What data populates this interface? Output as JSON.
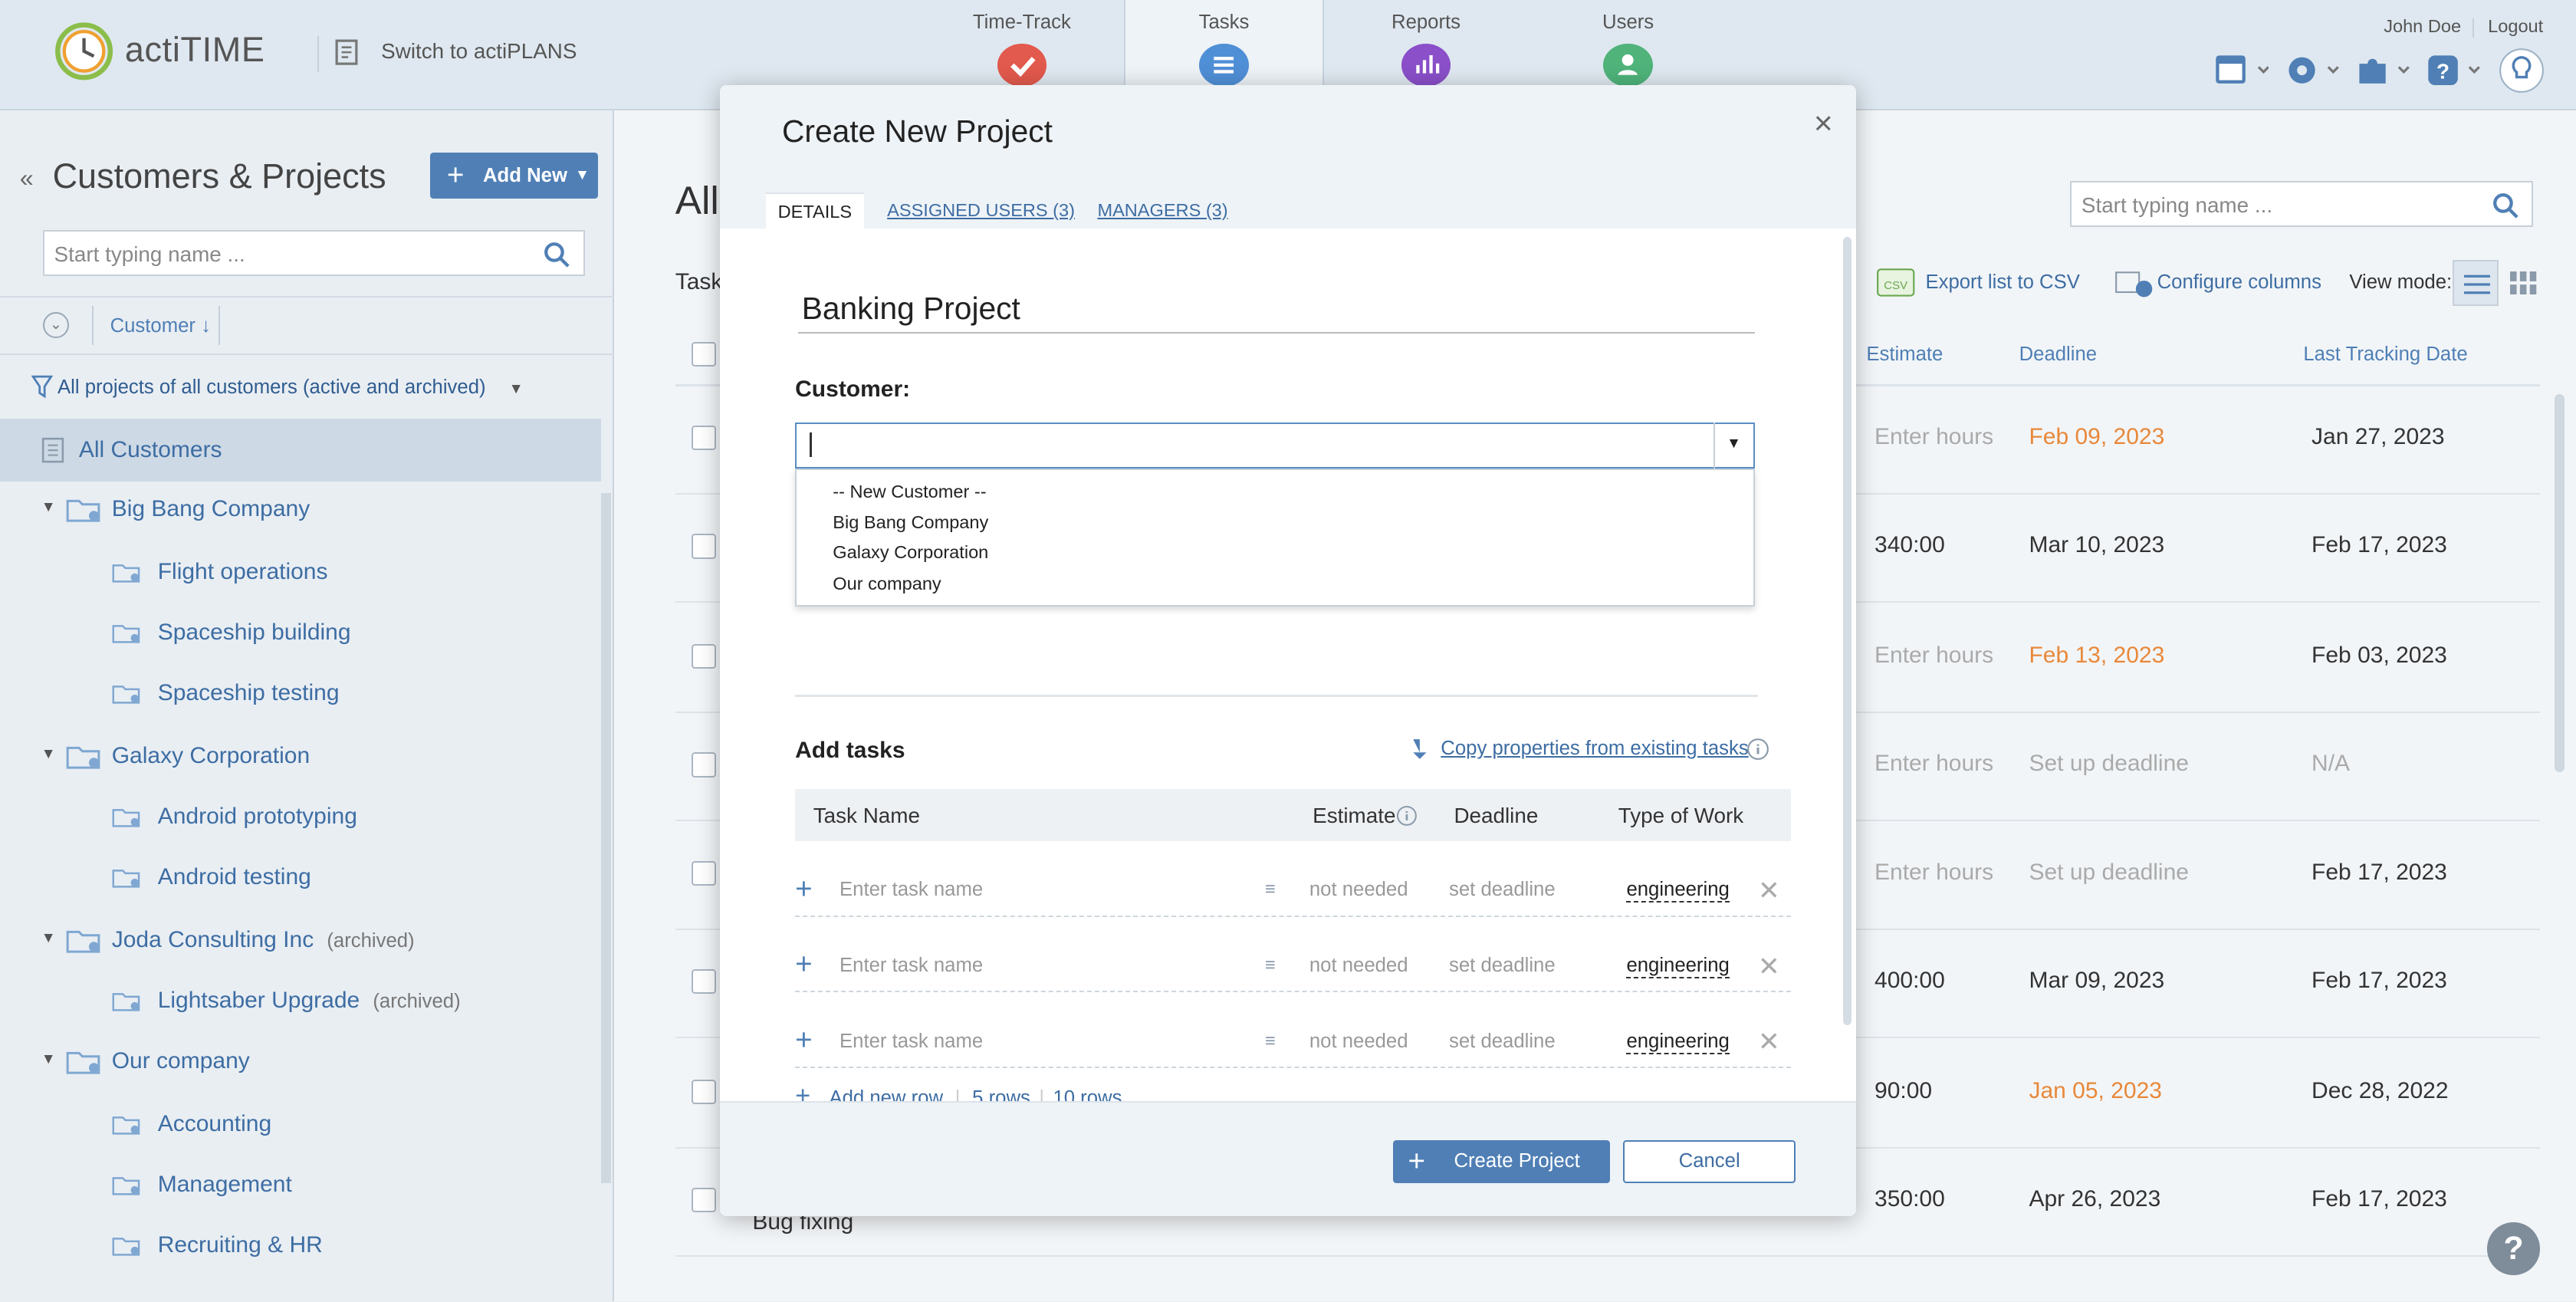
{
  "topbar": {
    "logo_text": "actiTIME",
    "switch_label": "Switch to actiPLANS",
    "tabs": [
      {
        "label": "Time-Track",
        "icon": "check-icon",
        "color": "#e2594d"
      },
      {
        "label": "Tasks",
        "icon": "list-icon",
        "color": "#4f8fd6"
      },
      {
        "label": "Reports",
        "icon": "chart-icon",
        "color": "#8a4fc9"
      },
      {
        "label": "Users",
        "icon": "user-icon",
        "color": "#4fb37a"
      }
    ],
    "user_name": "John Doe",
    "logout_label": "Logout"
  },
  "left": {
    "title": "Customers & Projects",
    "add_new_label": "Add New",
    "search_placeholder": "Start typing name ...",
    "column_label": "Customer",
    "filter_label": "All projects of all customers (active and archived)",
    "all_customers_label": "All Customers",
    "tree": [
      {
        "label": "Big Bang Company",
        "level": 0
      },
      {
        "label": "Flight operations",
        "level": 1
      },
      {
        "label": "Spaceship building",
        "level": 1
      },
      {
        "label": "Spaceship testing",
        "level": 1
      },
      {
        "label": "Galaxy Corporation",
        "level": 0
      },
      {
        "label": "Android prototyping",
        "level": 1
      },
      {
        "label": "Android testing",
        "level": 1
      },
      {
        "label": "Joda Consulting Inc",
        "level": 0,
        "archived": "(archived)"
      },
      {
        "label": "Lightsaber Upgrade",
        "level": 1,
        "archived": "(archived)"
      },
      {
        "label": "Our company",
        "level": 0
      },
      {
        "label": "Accounting",
        "level": 1
      },
      {
        "label": "Management",
        "level": 1
      },
      {
        "label": "Recruiting & HR",
        "level": 1
      }
    ]
  },
  "main": {
    "title": "All",
    "tasks_label": "Task",
    "search_placeholder": "Start typing name ...",
    "export_label": "Export list to CSV",
    "configure_label": "Configure columns",
    "view_mode_label": "View mode:",
    "columns": {
      "estimate": "Estimate",
      "deadline": "Deadline",
      "last_tracking": "Last Tracking Date"
    },
    "rows": [
      {
        "estimate": "Enter hours",
        "deadline": "Feb 09, 2023",
        "last": "Jan 27, 2023",
        "deadline_orange": true,
        "estimate_ph": true
      },
      {
        "estimate": "340:00",
        "deadline": "Mar 10, 2023",
        "last": "Feb 17, 2023"
      },
      {
        "estimate": "Enter hours",
        "deadline": "Feb 13, 2023",
        "last": "Feb 03, 2023",
        "deadline_orange": true,
        "estimate_ph": true
      },
      {
        "estimate": "Enter hours",
        "deadline": "Set up deadline",
        "last": "N/A",
        "estimate_ph": true,
        "deadline_ph": true,
        "last_ph": true
      },
      {
        "estimate": "Enter hours",
        "deadline": "Set up deadline",
        "last": "Feb 17, 2023",
        "estimate_ph": true,
        "deadline_ph": true
      },
      {
        "estimate": "400:00",
        "deadline": "Mar 09, 2023",
        "last": "Feb 17, 2023"
      },
      {
        "estimate": "90:00",
        "deadline": "Jan 05, 2023",
        "last": "Dec 28, 2022",
        "deadline_orange": true
      },
      {
        "estimate": "350:00",
        "deadline": "Apr 26, 2023",
        "last": "Feb 17, 2023",
        "name": "Bug fixing"
      }
    ]
  },
  "modal": {
    "title": "Create New Project",
    "tabs": {
      "details": "DETAILS",
      "users": "ASSIGNED USERS (3)",
      "managers": "MANAGERS (3)"
    },
    "project_name": "Banking Project",
    "customer_label": "Customer:",
    "customer_value": "",
    "customer_options": [
      "-- New Customer --",
      "Big Bang Company",
      "Galaxy Corporation",
      "Our company"
    ],
    "add_tasks_label": "Add tasks",
    "copy_label": "Copy properties from existing tasks",
    "task_columns": {
      "name": "Task Name",
      "estimate": "Estimate",
      "deadline": "Deadline",
      "type": "Type of Work"
    },
    "task_rows": [
      {
        "name_placeholder": "Enter task name",
        "estimate": "not needed",
        "deadline": "set deadline",
        "type": "engineering"
      },
      {
        "name_placeholder": "Enter task name",
        "estimate": "not needed",
        "deadline": "set deadline",
        "type": "engineering"
      },
      {
        "name_placeholder": "Enter task name",
        "estimate": "not needed",
        "deadline": "set deadline",
        "type": "engineering"
      }
    ],
    "add_row_label": "Add new row",
    "five_rows_label": "5 rows",
    "ten_rows_label": "10 rows",
    "create_label": "Create Project",
    "cancel_label": "Cancel"
  },
  "colors": {
    "accent": "#4f7fb5",
    "link": "#3d6da3",
    "warning": "#e8883a"
  }
}
